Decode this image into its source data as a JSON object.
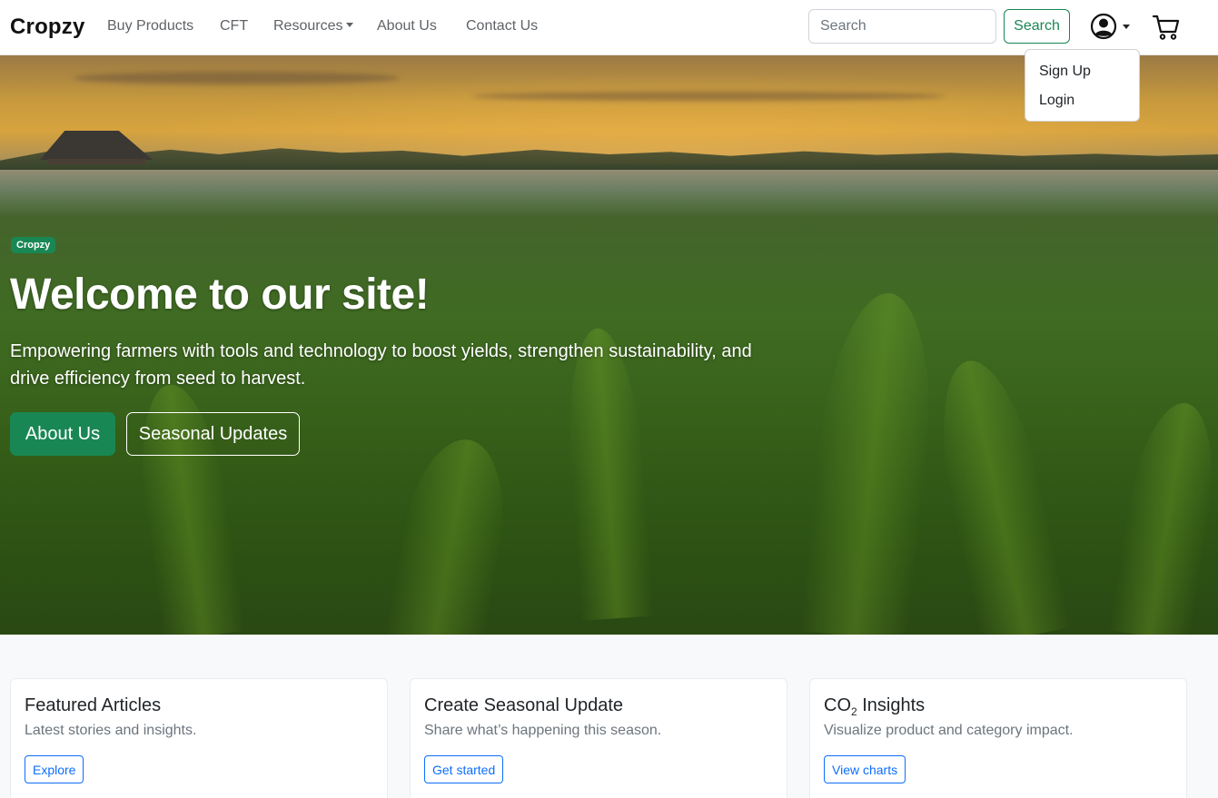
{
  "navbar": {
    "brand": "Cropzy",
    "links": [
      {
        "label": "Buy Products"
      },
      {
        "label": "CFT"
      },
      {
        "label": "Resources"
      },
      {
        "label": "About Us"
      },
      {
        "label": "Contact Us"
      }
    ],
    "search": {
      "placeholder": "Search",
      "value": "",
      "button_label": "Search"
    },
    "user_icon": "user-circle-icon",
    "cart_icon": "cart-icon"
  },
  "user_dropdown": {
    "items": [
      {
        "label": "Sign Up"
      },
      {
        "label": "Login"
      }
    ]
  },
  "hero": {
    "badge": "Cropzy",
    "title": "Welcome to our site!",
    "subtitle": "Empowering farmers with tools and technology to boost yields, strengthen sustainability, and drive efficiency from seed to harvest.",
    "primary_button": "About Us",
    "secondary_button": "Seasonal Updates"
  },
  "cards": [
    {
      "title": "Featured Articles",
      "text": "Latest stories and insights.",
      "button": "Explore"
    },
    {
      "title": "Create Seasonal Update",
      "text": "Share what’s happening this season.",
      "button": "Get started"
    },
    {
      "title_prefix": "CO",
      "title_sub": "2",
      "title_suffix": " Insights",
      "text": "Visualize product and category impact.",
      "button": "View charts"
    }
  ],
  "colors": {
    "brand_green": "#198754",
    "link_blue": "#0d6efd",
    "nav_text": "#5f6368"
  }
}
